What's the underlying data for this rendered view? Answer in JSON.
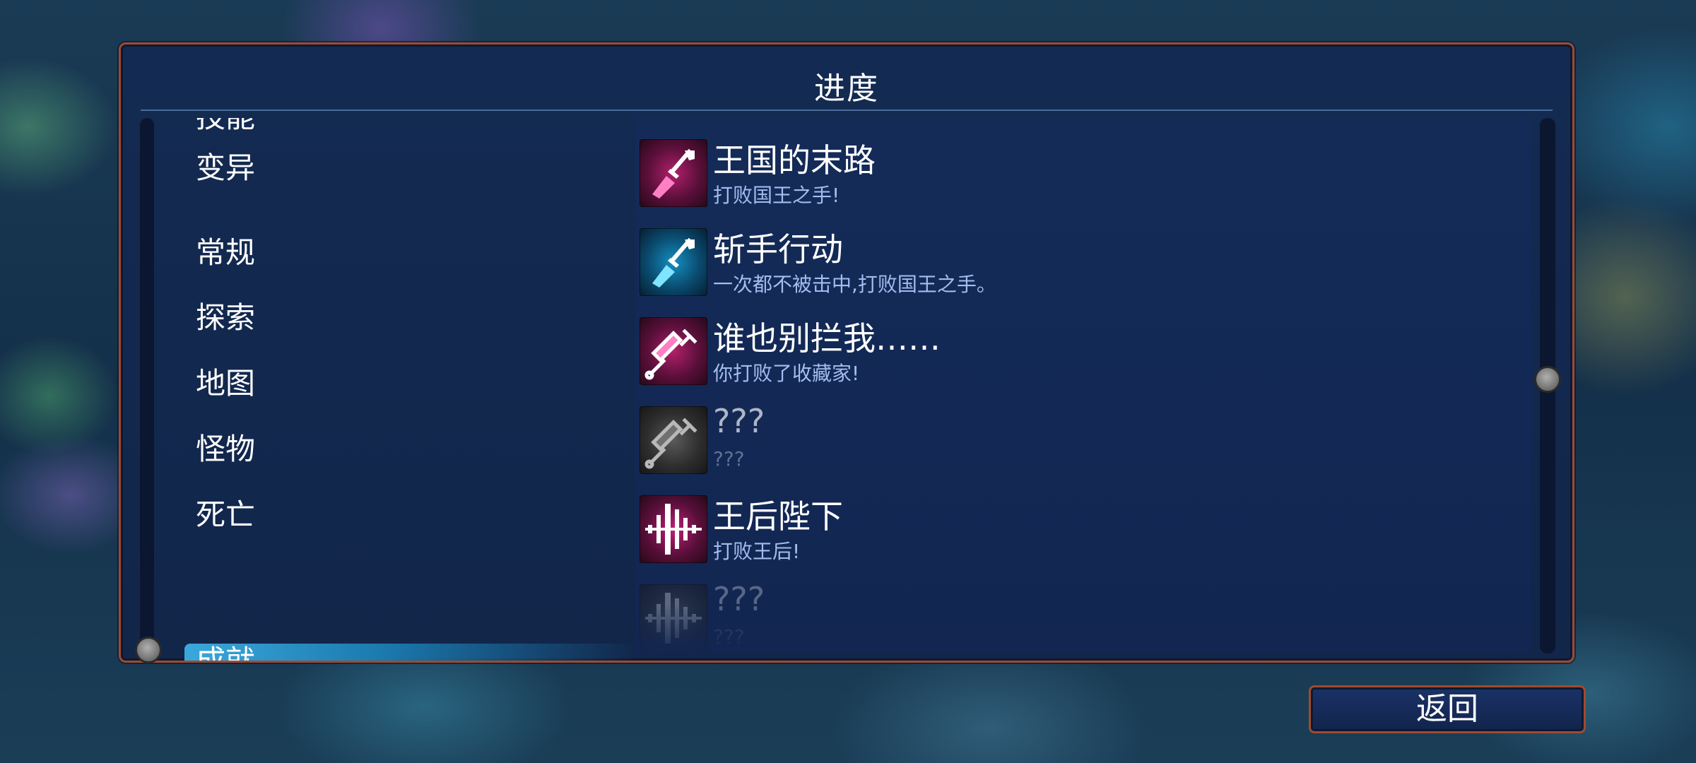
{
  "panel": {
    "title": "进度"
  },
  "categories": [
    {
      "label": "技能",
      "active": false
    },
    {
      "label": "变异",
      "active": false
    },
    {
      "label": "常规",
      "active": false
    },
    {
      "label": "探索",
      "active": false
    },
    {
      "label": "地图",
      "active": false
    },
    {
      "label": "怪物",
      "active": false
    },
    {
      "label": "死亡",
      "active": false
    },
    {
      "label": "成就",
      "active": true
    }
  ],
  "achievements": [
    {
      "title": "王国的末路",
      "description": "打败国王之手!",
      "icon": "dagger-icon",
      "color": "#ff1f8a",
      "locked": false
    },
    {
      "title": "斩手行动",
      "description": "一次都不被击中,打败国王之手。",
      "icon": "dagger-icon",
      "color": "#19c6ff",
      "locked": false
    },
    {
      "title": "谁也别拦我……",
      "description": "你打败了收藏家!",
      "icon": "syringe-icon",
      "color": "#ff1f8a",
      "locked": false
    },
    {
      "title": "???",
      "description": "???",
      "icon": "syringe-icon",
      "color": "#8c8c8c",
      "locked": true
    },
    {
      "title": "王后陛下",
      "description": "打败王后!",
      "icon": "soundwave-icon",
      "color": "#ff1f8a",
      "locked": false
    },
    {
      "title": "???",
      "description": "???",
      "icon": "soundwave-icon",
      "color": "#8c8c8c",
      "locked": true
    }
  ],
  "footer": {
    "back_label": "返回"
  },
  "colors": {
    "panel_border": "#a14a2e",
    "panel_bg": "#132a52",
    "active_category": "#3aa8dc",
    "description_text": "#a3bdf0"
  }
}
